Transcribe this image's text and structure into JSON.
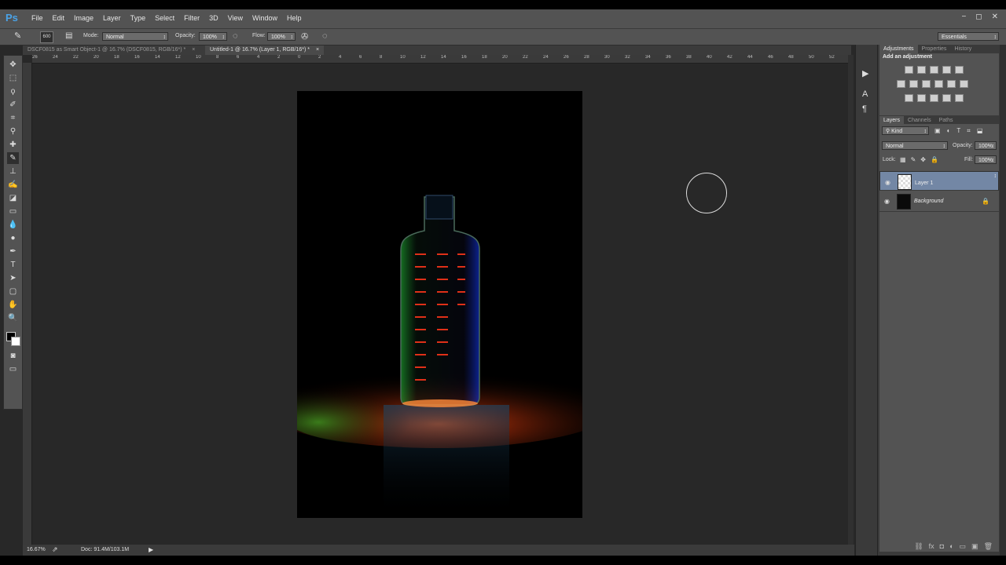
{
  "app": {
    "logo": "Ps"
  },
  "menu": [
    "File",
    "Edit",
    "Image",
    "Layer",
    "Type",
    "Select",
    "Filter",
    "3D",
    "View",
    "Window",
    "Help"
  ],
  "window_controls": [
    "−",
    "◻",
    "✕"
  ],
  "options": {
    "brush_size": "600",
    "mode_label": "Mode:",
    "mode_value": "Normal",
    "opacity_label": "Opacity:",
    "opacity_value": "100%",
    "flow_label": "Flow:",
    "flow_value": "100%",
    "workspace": "Essentials"
  },
  "tabs": [
    {
      "label": "DSCF0815 as Smart Object-1 @ 16.7% (DSCF0815, RGB/16*) *",
      "close": "×"
    },
    {
      "label": "Untitled-1 @ 16.7% (Layer 1, RGB/16*) *",
      "close": "×"
    }
  ],
  "ruler_ticks": [
    "26",
    "24",
    "22",
    "20",
    "18",
    "16",
    "14",
    "12",
    "10",
    "8",
    "6",
    "4",
    "2",
    "0",
    "2",
    "4",
    "6",
    "8",
    "10",
    "12",
    "14",
    "16",
    "18",
    "20",
    "22",
    "24",
    "26",
    "28",
    "30",
    "32",
    "34",
    "36",
    "38",
    "40",
    "42",
    "44",
    "46",
    "48",
    "50",
    "52"
  ],
  "status": {
    "zoom": "16.67%",
    "doc": "Doc: 91.4M/103.1M"
  },
  "panels": {
    "adj_tabs": [
      "Adjustments",
      "Properties",
      "History"
    ],
    "adj_title": "Add an adjustment",
    "layer_tabs": [
      "Layers",
      "Channels",
      "Paths"
    ],
    "kind": "Kind",
    "blend": "Normal",
    "opacity_label": "Opacity:",
    "opacity_value": "100%",
    "lock_label": "Lock:",
    "fill_label": "Fill:",
    "fill_value": "100%",
    "layers": [
      {
        "name": "Layer 1",
        "selected": true
      },
      {
        "name": "Background",
        "selected": false
      }
    ],
    "footer_icons": [
      "⛓",
      "fx",
      "◘",
      "◐",
      "▭",
      "▣",
      "🗑"
    ]
  },
  "colors": {
    "accent": "#4aa3e8",
    "selected_layer": "#7387a5"
  }
}
